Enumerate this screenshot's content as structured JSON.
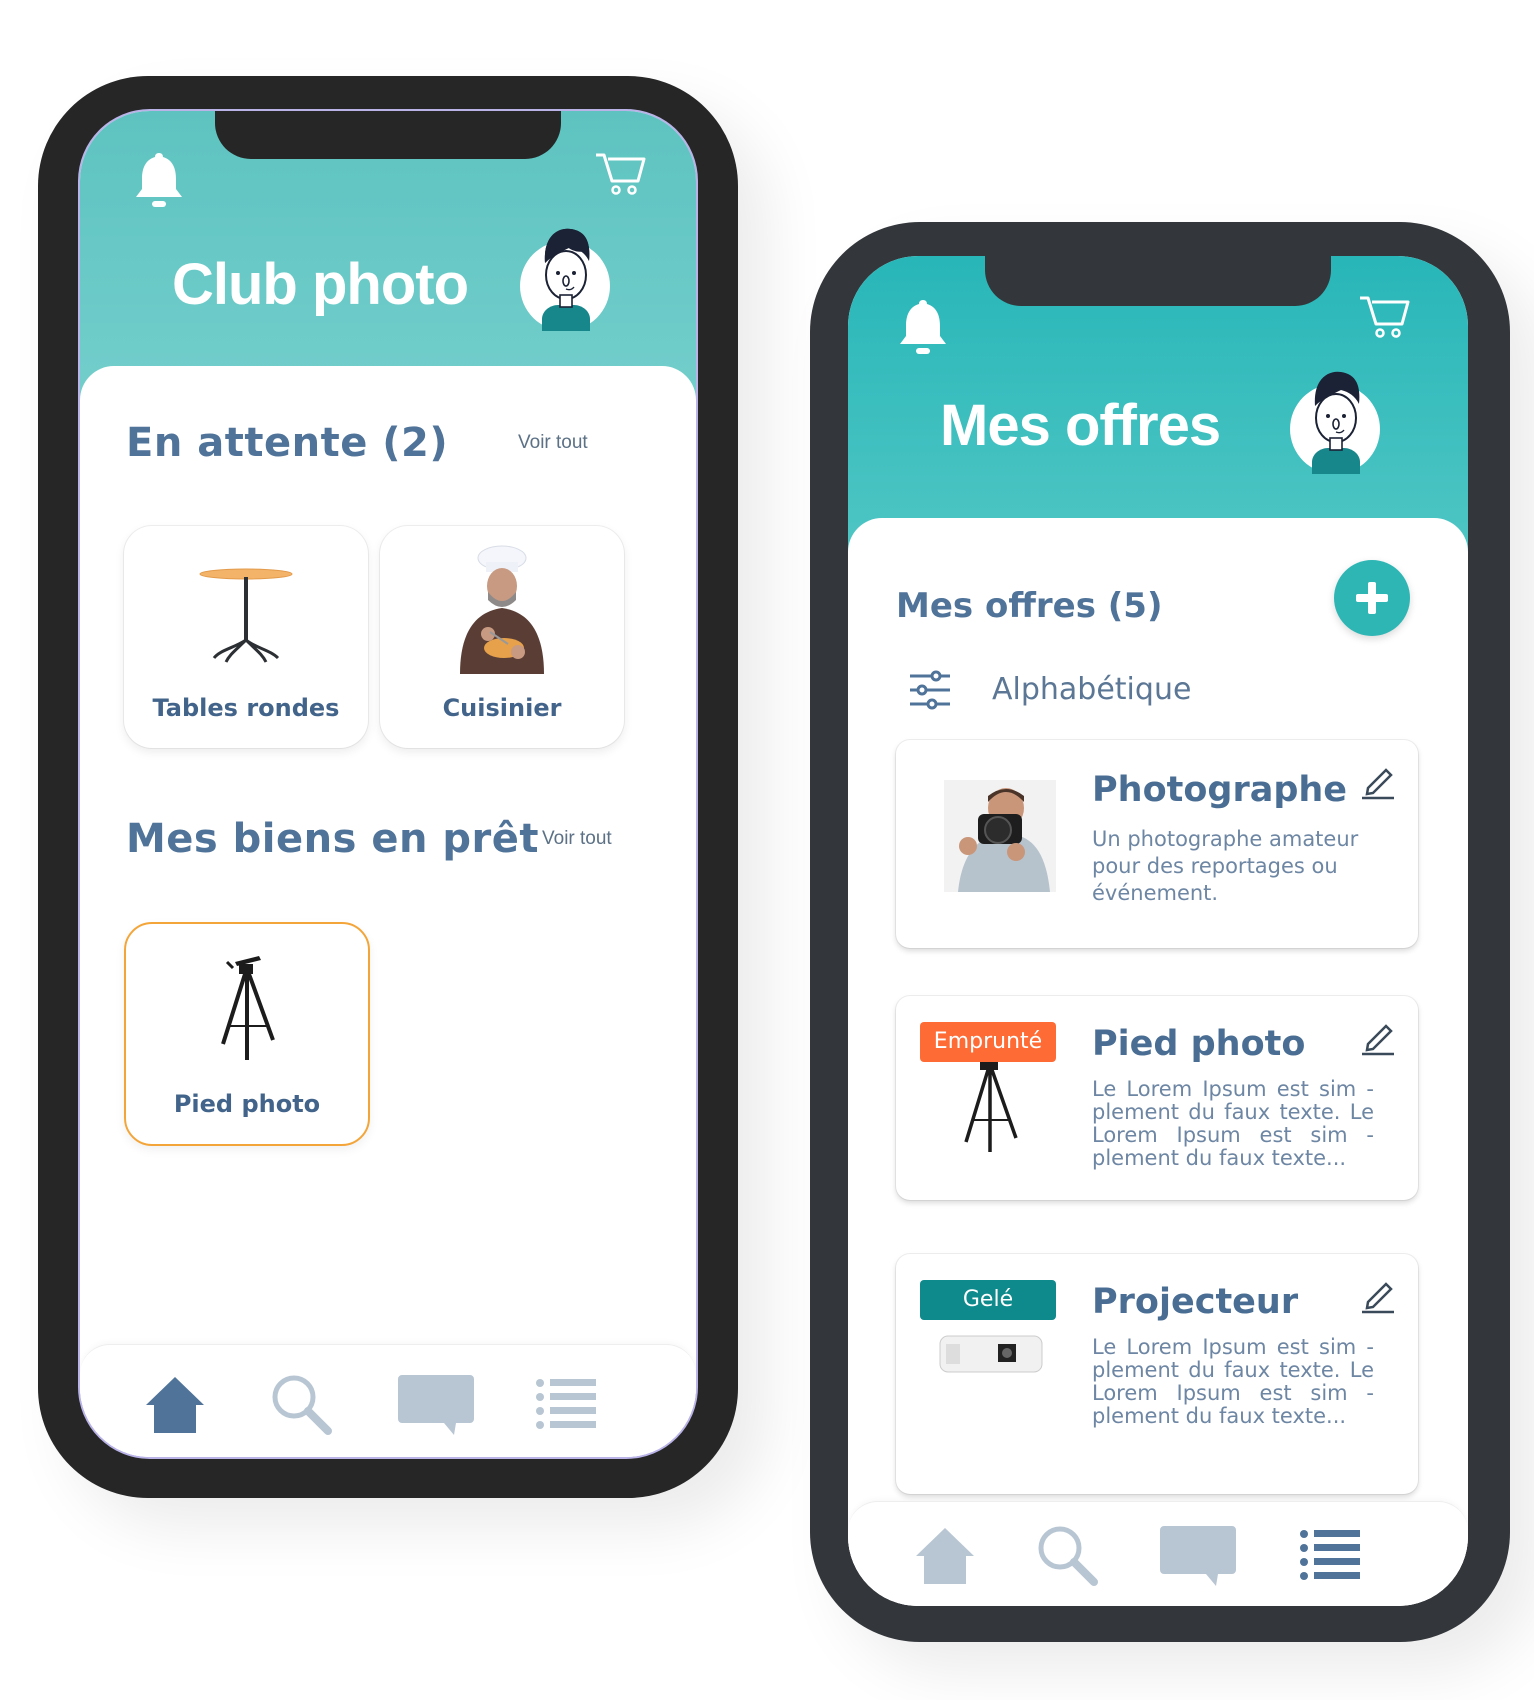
{
  "colors": {
    "teal_header_left": "#5ec3c0",
    "teal_header_right": "#28b6b8",
    "heading_blue": "#4f7399",
    "borrowed_orange": "#ff6b35",
    "frozen_teal": "#0e8a8c",
    "active_border_orange": "#f4a53a"
  },
  "phone_left": {
    "header": {
      "title": "Club photo",
      "bell_icon": "bell-icon",
      "cart_icon": "cart-icon",
      "avatar": "user-avatar"
    },
    "pending": {
      "title": "En attente (2)",
      "see_all": "Voir tout",
      "items": [
        {
          "label": "Tables rondes",
          "image": "round-table"
        },
        {
          "label": "Cuisinier",
          "image": "chef"
        }
      ]
    },
    "lent": {
      "title": "Mes biens en prêt",
      "see_all": "Voir tout",
      "items": [
        {
          "label": "Pied photo",
          "image": "tripod"
        }
      ]
    },
    "nav": {
      "active": "home",
      "items": [
        "home",
        "search",
        "messages",
        "list"
      ]
    }
  },
  "phone_right": {
    "header": {
      "title": "Mes offres",
      "bell_icon": "bell-icon",
      "cart_icon": "cart-icon",
      "avatar": "user-avatar"
    },
    "offers": {
      "title": "Mes offres (5)",
      "add_label": "+",
      "sort_label": "Alphabétique",
      "items": [
        {
          "title": "Photographe",
          "badge": "",
          "description": "Un photographe amateur pour des reportages ou événement."
        },
        {
          "title": "Pied photo",
          "badge": "Emprunté",
          "description": "Le Lorem Ipsum est sim - plement du faux texte. Le Lorem Ipsum est sim - plement du faux texte..."
        },
        {
          "title": "Projecteur",
          "badge": "Gelé",
          "description": "Le Lorem Ipsum est sim - plement du faux texte. Le Lorem Ipsum est sim - plement du faux texte..."
        }
      ]
    },
    "nav": {
      "active": "list",
      "items": [
        "home",
        "search",
        "messages",
        "list"
      ]
    }
  }
}
